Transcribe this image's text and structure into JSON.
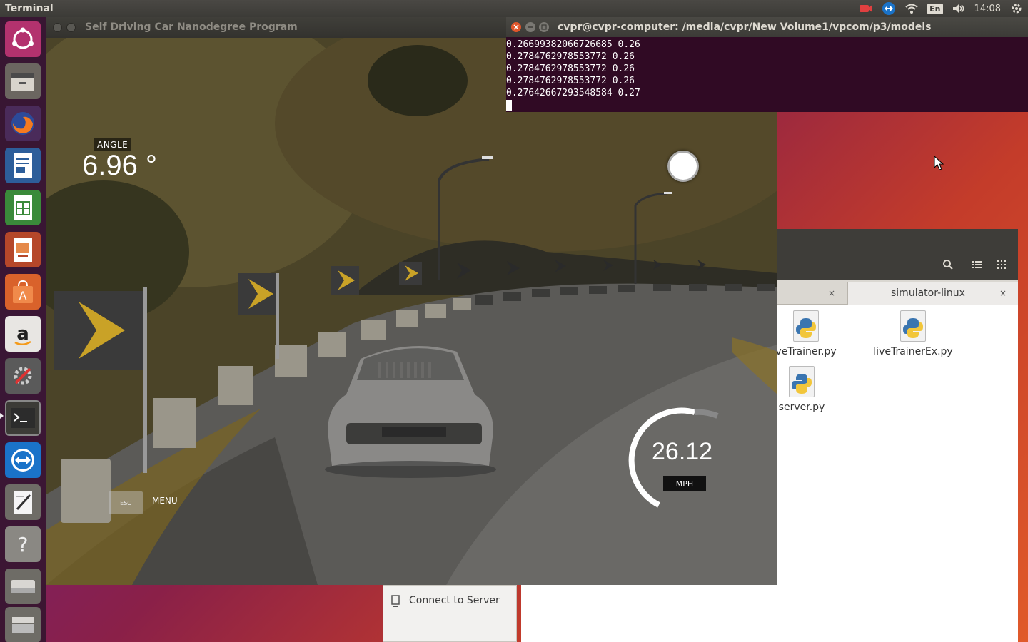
{
  "top_panel": {
    "app_name": "Terminal",
    "keyboard_layout": "En",
    "clock": "14:08"
  },
  "launcher": {
    "items": [
      "ubuntu-dash-icon",
      "files-icon",
      "firefox-icon",
      "writer-icon",
      "calc-icon",
      "impress-icon",
      "software-center-icon",
      "amazon-icon",
      "system-settings-icon",
      "terminal-icon",
      "teamviewer-icon",
      "text-editor-icon",
      "help-icon",
      "drive-icon",
      "trash-icon"
    ]
  },
  "simulator": {
    "window_title": "Self Driving Car Nanodegree Program",
    "angle_label": "ANGLE",
    "angle_value": "6.96 °",
    "speed_value": "26.12",
    "speed_unit": "MPH",
    "esc_key": "ESC",
    "menu_label": "MENU"
  },
  "terminal": {
    "title": "cvpr@cvpr-computer: /media/cvpr/New Volume1/vpcom/p3/models",
    "lines": [
      "0.26699382066726685 0.26",
      "0.2784762978553772 0.26",
      "0.2784762978553772 0.26",
      "0.2784762978553772 0.26",
      "0.27642667293548584 0.27"
    ]
  },
  "files": {
    "tabs": [
      {
        "label": ""
      },
      {
        "label": "simulator-linux"
      }
    ],
    "items": [
      {
        "name": "veTrainer.py"
      },
      {
        "name": "liveTrainerEx.py"
      },
      {
        "name": "server.py"
      }
    ],
    "connect_to_server": "Connect to Server"
  },
  "colors": {
    "terminal_bg": "#300a24",
    "panel_bg": "#3c3b37",
    "close_orange": "#e0562b"
  }
}
